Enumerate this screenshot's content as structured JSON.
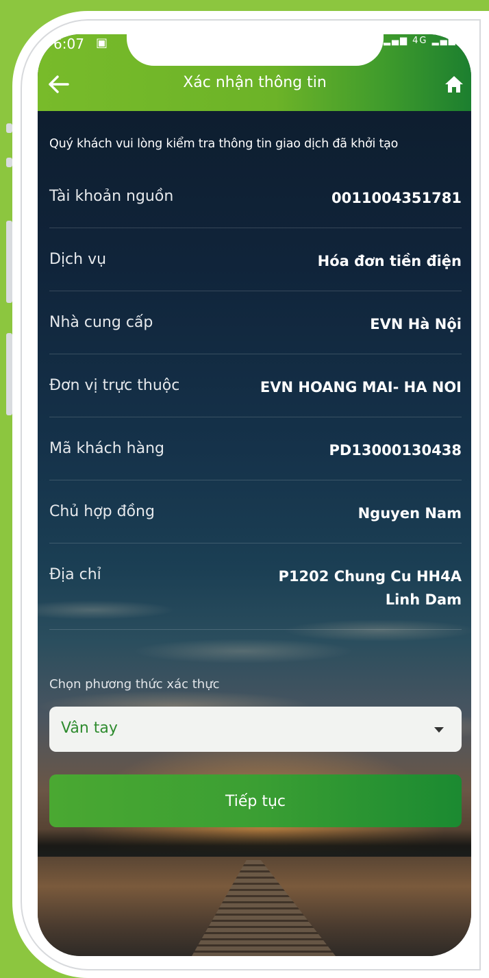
{
  "status_bar": {
    "time": "6:07",
    "network_type": "4G"
  },
  "header": {
    "title": "Xác nhận thông tin",
    "back_icon": "arrow-left-icon",
    "home_icon": "home-icon"
  },
  "intro": "Quý khách vui lòng kiểm tra thông tin giao dịch đã khởi tạo",
  "details": [
    {
      "label": "Tài khoản nguồn",
      "value": "0011004351781"
    },
    {
      "label": "Dịch vụ",
      "value": "Hóa đơn tiền điện"
    },
    {
      "label": "Nhà cung cấp",
      "value": "EVN Hà Nội"
    },
    {
      "label": "Đơn vị trực thuộc",
      "value": "EVN HOANG MAI- HA NOI"
    },
    {
      "label": "Mã khách hàng",
      "value": "PD13000130438"
    },
    {
      "label": "Chủ hợp đồng",
      "value": "Nguyen Nam"
    },
    {
      "label": "Địa chỉ",
      "value_line1": "P1202 Chung Cu HH4A",
      "value_line2": "Linh Dam"
    }
  ],
  "auth": {
    "label": "Chọn phương thức xác thực",
    "selected": "Vân tay"
  },
  "submit_label": "Tiếp tục",
  "colors": {
    "page_background": "#8cc63f",
    "header_green": "#6cb328",
    "button_green": "#3b9f33",
    "select_text": "#2e8b2e"
  }
}
